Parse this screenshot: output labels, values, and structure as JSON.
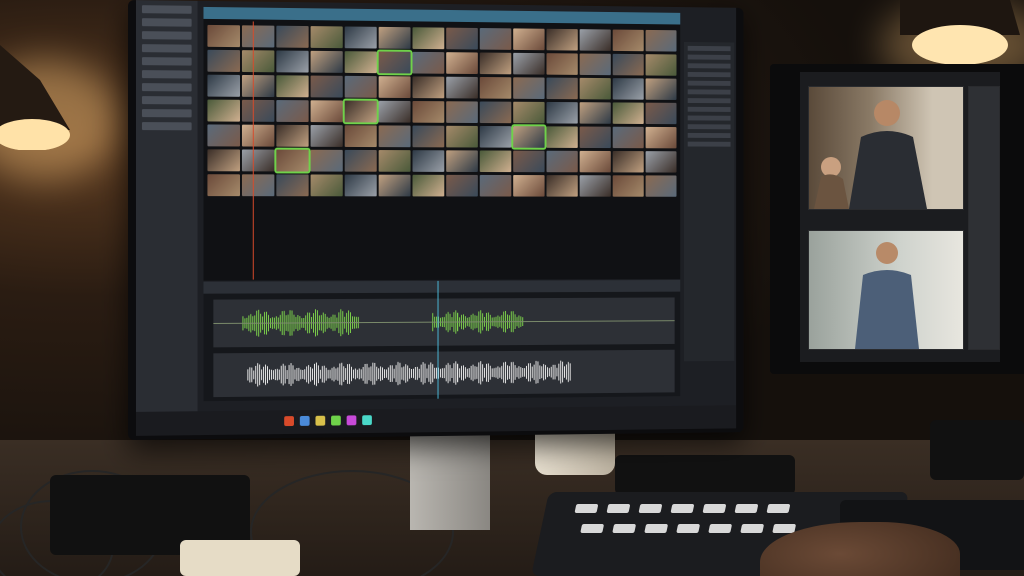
{
  "colors": {
    "accent_timeline": "#7bd04a",
    "selection": "#6fd24a",
    "playhead": "#d84a2a",
    "header_bar": "#3a6f8a"
  },
  "icons": [
    "lamp-icon",
    "waveform-icon",
    "playhead-icon"
  ],
  "scene": {
    "editing_app": {
      "clip_count": 98,
      "selected_clips": 4
    },
    "preview_monitor": {
      "frames": 2
    }
  }
}
